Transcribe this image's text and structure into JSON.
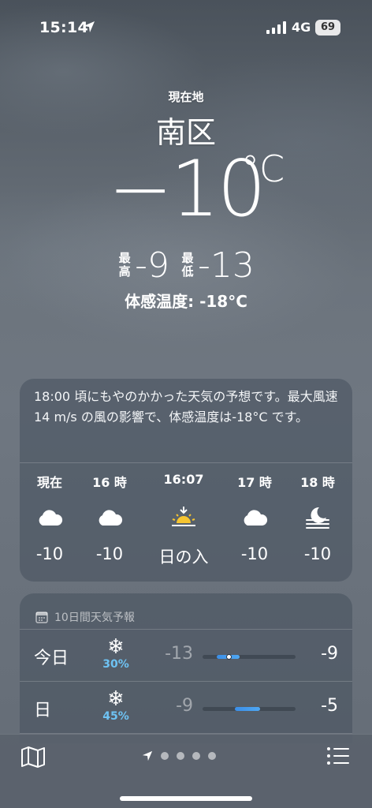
{
  "status_bar": {
    "time": "15:14",
    "network": "4G",
    "battery": "69"
  },
  "header": {
    "location_label": "現在地",
    "city": "南区",
    "temperature": "−10",
    "unit": "°C",
    "high_label": "最\n高",
    "high": "-9",
    "low_label": "最\n低",
    "low": "-13",
    "feels_like": "体感温度: -18°C"
  },
  "hourly_card": {
    "summary": "18:00 頃にもやのかかった天気の予想です。最大風速 14 m/s の風の影響で、体感温度は-18°C です。",
    "hours": [
      {
        "label": "現在",
        "icon": "cloud-icon",
        "value": "-10"
      },
      {
        "label": "16 時",
        "icon": "cloud-icon",
        "value": "-10"
      },
      {
        "label": "16:07",
        "icon": "sunset-icon",
        "value": "日の入"
      },
      {
        "label": "17 時",
        "icon": "cloud-icon",
        "value": "-10"
      },
      {
        "label": "18 時",
        "icon": "moon-fog-icon",
        "value": "-10"
      }
    ]
  },
  "daily_card": {
    "title": "10日間天気予報",
    "days": [
      {
        "name": "今日",
        "icon": "snowflake-icon",
        "precip": "30%",
        "low": "-13",
        "high": "-9",
        "range_start": 0.15,
        "range_end": 0.4,
        "current": 0.28
      },
      {
        "name": "日",
        "icon": "snowflake-icon",
        "precip": "45%",
        "low": "-9",
        "high": "-5",
        "range_start": 0.35,
        "range_end": 0.62
      }
    ]
  },
  "bottom_bar": {
    "page_count": 4
  },
  "colors": {
    "precip": "#6ec3f4",
    "temp_bar": "#4fa7f2",
    "sun": "#f6c531"
  }
}
